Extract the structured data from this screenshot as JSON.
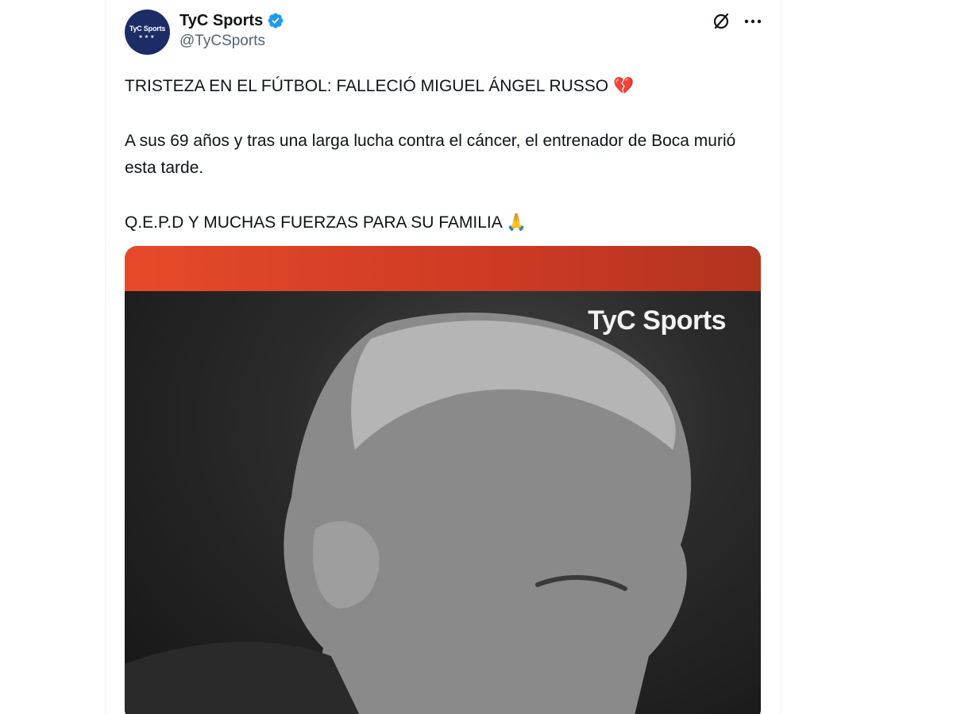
{
  "author": {
    "display_name": "TyC Sports",
    "handle": "@TyCSports",
    "avatar_text": "TyC Sports",
    "avatar_stars": "★★★",
    "verified_icon": "verified-badge-icon",
    "colors": {
      "verified": "#1d9bf0",
      "avatar_bg": "#1c2c66"
    }
  },
  "actions": {
    "grok_icon": "grok-icon",
    "more_icon": "more-options-icon"
  },
  "tweet": {
    "line1": "TRISTEZA EN EL FÚTBOL: FALLECIÓ MIGUEL ÁNGEL RUSSO 💔",
    "line2": "A sus 69 años y tras una larga lucha contra el cáncer, el entrenador de Boca murió esta tarde.",
    "line3": "Q.E.P.D Y MUCHAS FUERZAS PARA SU FAMILIA 🙏"
  },
  "media": {
    "watermark": "TyC Sports",
    "banner_color": "#e64a2a"
  }
}
